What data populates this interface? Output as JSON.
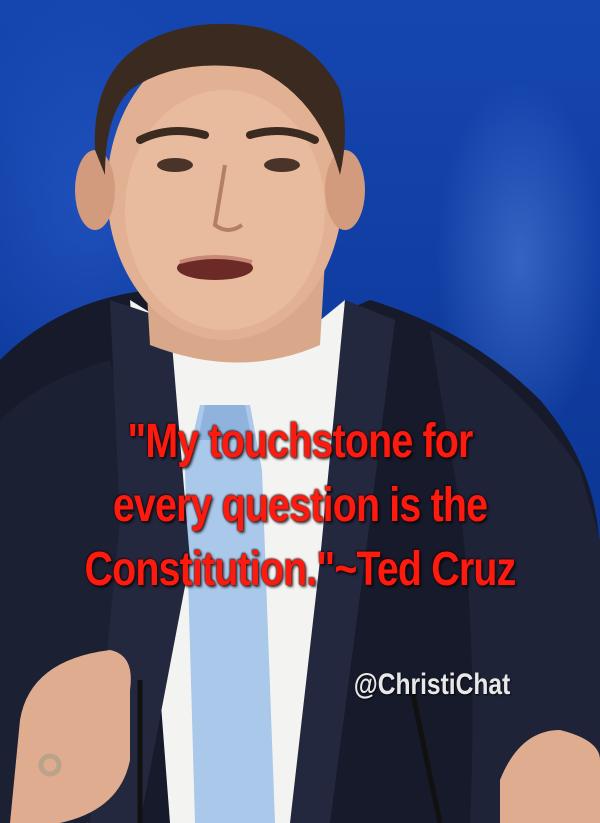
{
  "quote": {
    "lines": [
      "\"My touchstone for",
      "every question is the",
      "Constitution.\"~Ted Cruz"
    ],
    "color": "#ff1a10"
  },
  "watermark": {
    "handle": "@ChristiChat"
  },
  "background": {
    "color": "#1546b0"
  }
}
